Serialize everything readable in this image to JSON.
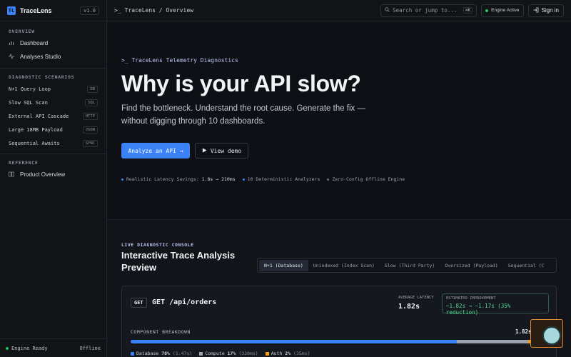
{
  "brand": {
    "logo": "TL",
    "name": "TraceLens",
    "version": "v1.0"
  },
  "sidebar": {
    "overview_title": "OVERVIEW",
    "overview_items": [
      {
        "label": "Dashboard",
        "icon": "bar-chart-icon"
      },
      {
        "label": "Analyses Studio",
        "icon": "activity-icon"
      }
    ],
    "scenarios_title": "DIAGNOSTIC SCENARIOS",
    "scenarios": [
      {
        "label": "N+1 Query Loop",
        "tag": "DB"
      },
      {
        "label": "Slow SQL Scan",
        "tag": "SQL"
      },
      {
        "label": "External API Cascade",
        "tag": "HTTP"
      },
      {
        "label": "Large 18MB Payload",
        "tag": "JSON"
      },
      {
        "label": "Sequential Awaits",
        "tag": "SYNC"
      }
    ],
    "reference_title": "REFERENCE",
    "reference_items": [
      {
        "label": "Product Overview",
        "icon": "book-icon"
      }
    ],
    "footer": {
      "status": "Engine Ready",
      "mode": "Offline"
    }
  },
  "topbar": {
    "breadcrumb": "TraceLens / Overview",
    "search_placeholder": "Search or jump to...",
    "search_shortcut": "⌘K",
    "engine_status": "Engine Active",
    "signin": "Sign in"
  },
  "hero": {
    "eyebrow": "TraceLens Telemetry Diagnostics",
    "title": "Why is your API slow?",
    "subtitle": "Find the bottleneck. Understand the root cause. Generate the fix — without digging through 10 dashboards.",
    "primary_cta": "Analyze an API →",
    "secondary_cta": "View demo",
    "stats": [
      {
        "label": "Realistic Latency Savings:",
        "value": "1.8s → 210ms"
      },
      {
        "label": "10 Deterministic Analyzers",
        "value": ""
      },
      {
        "label": "Zero-Config Offline Engine",
        "value": ""
      }
    ]
  },
  "console": {
    "eyebrow": "LIVE DIAGNOSTIC CONSOLE",
    "title": "Interactive Trace Analysis Preview",
    "tabs": [
      {
        "label": "N+1 (Database)",
        "active": true
      },
      {
        "label": "Unindexed (Index Scan)",
        "active": false
      },
      {
        "label": "Slow (Third Party)",
        "active": false
      },
      {
        "label": "Oversized (Payload)",
        "active": false
      },
      {
        "label": "Sequential (C",
        "active": false
      }
    ],
    "card": {
      "method": "GET",
      "endpoint": "GET /api/orders",
      "avg_latency_label": "AVERAGE LATENCY",
      "avg_latency": "1.82s",
      "improvement_label": "ESTIMATED IMPROVEMENT",
      "improvement": "~1.82s → ~1.17s (35% reduction)",
      "breakdown_label": "COMPONENT BREAKDOWN",
      "total": "1.82s total",
      "components": [
        {
          "name": "Database",
          "pct": "78%",
          "time": "(1.47s)",
          "share": 0.78,
          "color": "#3b82f6"
        },
        {
          "name": "Compute",
          "pct": "17%",
          "time": "(320ms)",
          "share": 0.17,
          "color": "#9ca3af"
        },
        {
          "name": "Auth",
          "pct": "2%",
          "time": "(35ms)",
          "share": 0.02,
          "color": "#f59e0b"
        }
      ]
    }
  }
}
